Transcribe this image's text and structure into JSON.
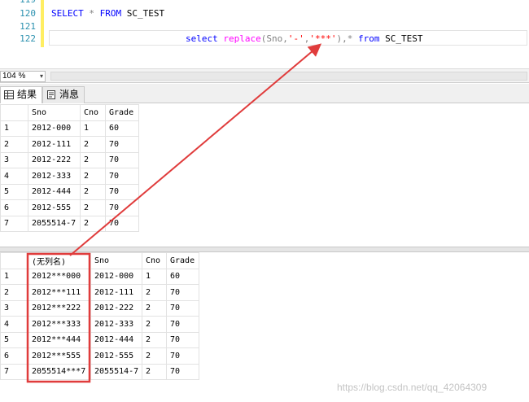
{
  "editor": {
    "line_numbers": [
      "119",
      "120",
      "121",
      "122"
    ],
    "line120": {
      "kw1": "SELECT",
      "star": " * ",
      "kw2": "FROM",
      "table": " SC_TEST"
    },
    "line122": {
      "kw1": "select",
      "fn": "replace",
      "open": "(Sno,",
      "s1": "'-'",
      "comma": ",",
      "s2": "'***'",
      "close": "),",
      "star": "* ",
      "kw2": "from",
      "table": " SC_TEST"
    }
  },
  "zoom": {
    "value": "104 %",
    "arrow": "▾"
  },
  "tabs": [
    {
      "label": "结果",
      "icon": "grid-icon"
    },
    {
      "label": "消息",
      "icon": "message-icon"
    }
  ],
  "grid1": {
    "columns": [
      "Sno",
      "Cno",
      "Grade"
    ],
    "rows": [
      [
        "1",
        "2012-000",
        "1",
        "60"
      ],
      [
        "2",
        "2012-111",
        "2",
        "70"
      ],
      [
        "3",
        "2012-222",
        "2",
        "70"
      ],
      [
        "4",
        "2012-333",
        "2",
        "70"
      ],
      [
        "5",
        "2012-444",
        "2",
        "70"
      ],
      [
        "6",
        "2012-555",
        "2",
        "70"
      ],
      [
        "7",
        "2055514-7",
        "2",
        "70"
      ]
    ]
  },
  "grid2": {
    "columns": [
      "(无列名)",
      "Sno",
      "Cno",
      "Grade"
    ],
    "rows": [
      [
        "1",
        "2012***000",
        "2012-000",
        "1",
        "60"
      ],
      [
        "2",
        "2012***111",
        "2012-111",
        "2",
        "70"
      ],
      [
        "3",
        "2012***222",
        "2012-222",
        "2",
        "70"
      ],
      [
        "4",
        "2012***333",
        "2012-333",
        "2",
        "70"
      ],
      [
        "5",
        "2012***444",
        "2012-444",
        "2",
        "70"
      ],
      [
        "6",
        "2012***555",
        "2012-555",
        "2",
        "70"
      ],
      [
        "7",
        "2055514***7",
        "2055514-7",
        "2",
        "70"
      ]
    ]
  },
  "annotation": {
    "color": "#e03c3c"
  },
  "watermark": "https://blog.csdn.net/qq_42064309"
}
